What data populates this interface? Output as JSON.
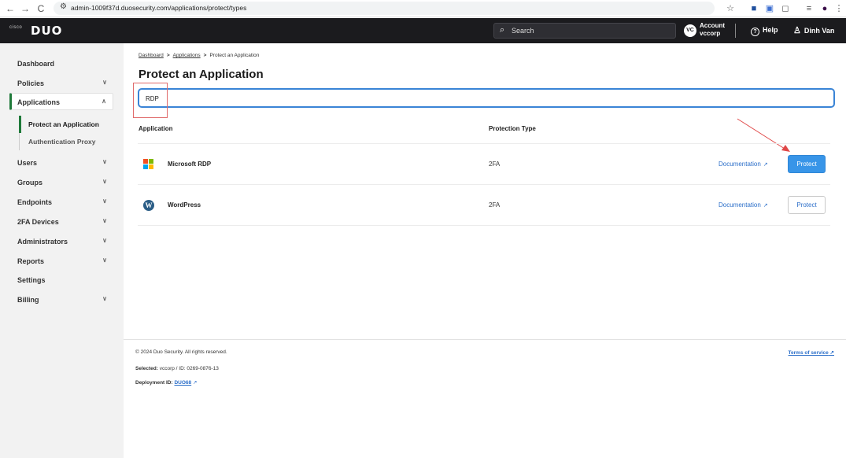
{
  "browser": {
    "back": "←",
    "forward": "→",
    "reload": "C",
    "url": "admin-1009f37d.duosecurity.com/applications/protect/types"
  },
  "header": {
    "brand_small": "cisco",
    "brand": "DUO",
    "search_placeholder": "Search",
    "account_avatar": "VC",
    "account_label": "Account",
    "account_name": "vccorp",
    "help_label": "Help",
    "user_name": "Dinh Van"
  },
  "sidebar": {
    "items": [
      {
        "label": "Dashboard"
      },
      {
        "label": "Policies",
        "chevron": "∨"
      },
      {
        "label": "Applications",
        "chevron": "∧"
      },
      {
        "label": "Users",
        "chevron": "∨"
      },
      {
        "label": "Groups",
        "chevron": "∨"
      },
      {
        "label": "Endpoints",
        "chevron": "∨"
      },
      {
        "label": "2FA Devices",
        "chevron": "∨"
      },
      {
        "label": "Administrators",
        "chevron": "∨"
      },
      {
        "label": "Reports",
        "chevron": "∨"
      },
      {
        "label": "Settings"
      },
      {
        "label": "Billing",
        "chevron": "∨"
      }
    ],
    "subitems": [
      {
        "label": "Protect an Application"
      },
      {
        "label": "Authentication Proxy"
      }
    ]
  },
  "main": {
    "breadcrumb": [
      "Dashboard",
      "Applications",
      "Protect an Application"
    ],
    "breadcrumb_sep": ">",
    "title": "Protect an Application",
    "filter_value": "RDP",
    "columns": {
      "application": "Application",
      "protection_type": "Protection Type"
    },
    "rows": [
      {
        "name": "Microsoft RDP",
        "protection_type": "2FA",
        "doc_label": "Documentation",
        "button": "Protect"
      },
      {
        "name": "WordPress",
        "protection_type": "2FA",
        "doc_label": "Documentation",
        "button": "Protect"
      }
    ]
  },
  "footer": {
    "copyright": "© 2024 Duo Security. All rights reserved.",
    "terms": "Terms of service",
    "selected_label": "Selected:",
    "selected_value": "vccorp / ID: 0269-0876-13",
    "deployment_label": "Deployment ID:",
    "deployment_value": "DUO68"
  },
  "colors": {
    "header_bg": "#1b1b1e",
    "accent_green": "#1f7a3a",
    "primary_button": "#3895e8",
    "link_blue": "#2c6fc9",
    "annotation_red": "#e06a6a"
  }
}
